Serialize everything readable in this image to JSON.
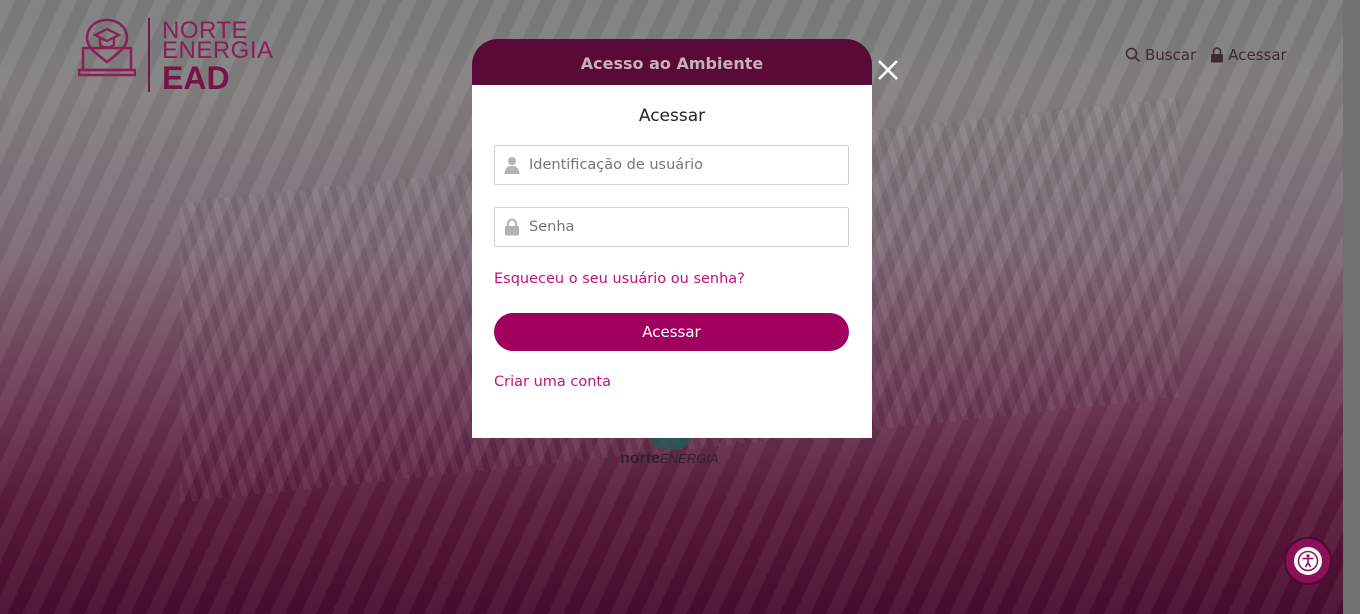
{
  "header": {
    "logo": {
      "line1": "NORTE",
      "line2": "ENERGIA",
      "line3": "EAD"
    },
    "nav": [
      {
        "label": "Buscar",
        "icon": "search-icon"
      },
      {
        "label": "Acessar",
        "icon": "lock-icon"
      }
    ]
  },
  "background_logo": {
    "text_bold": "norte",
    "text_italic": "ENERGIA"
  },
  "modal": {
    "title": "Acesso ao Ambiente",
    "heading": "Acessar",
    "username": {
      "placeholder": "Identificação de usuário",
      "value": "",
      "icon": "user-icon"
    },
    "password": {
      "placeholder": "Senha",
      "value": "",
      "icon": "lock-icon"
    },
    "forgot_link": "Esqueceu o seu usuário ou senha?",
    "submit_label": "Acessar",
    "create_account_link": "Criar uma conta",
    "close_icon": "close-icon"
  },
  "accessibility": {
    "icon": "accessibility-icon"
  },
  "colors": {
    "brand": "#a0005e",
    "modal_header": "#5a0a36",
    "link": "#c0127a"
  }
}
